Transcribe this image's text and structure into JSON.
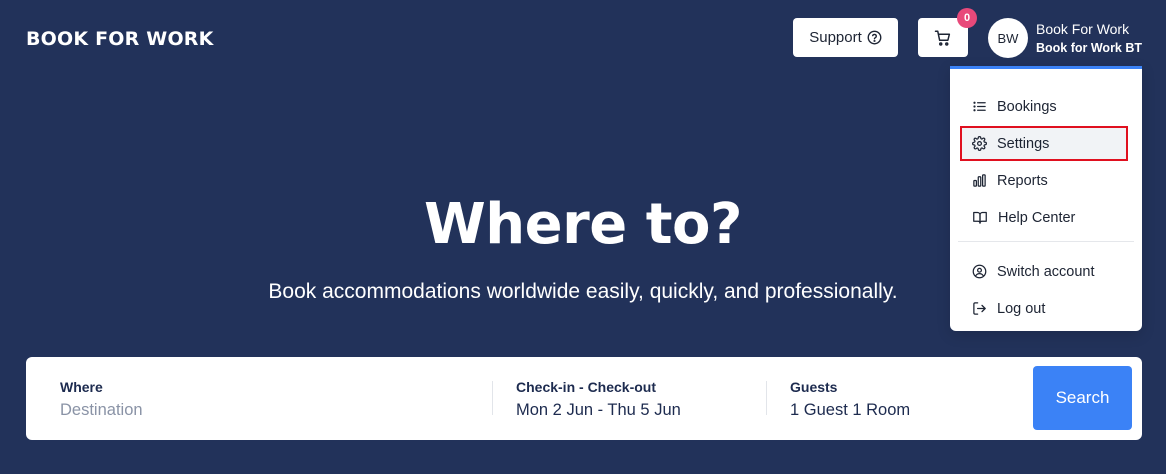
{
  "header": {
    "logo": "BOOK FOR WORK",
    "support_label": "Support",
    "cart_count": "0",
    "avatar_initials": "BW",
    "account_name": "Book For Work",
    "account_sub": "Book for Work BT"
  },
  "menu": {
    "items": [
      {
        "label": "Bookings",
        "icon": "list-icon"
      },
      {
        "label": "Settings",
        "icon": "gear-icon"
      },
      {
        "label": "Reports",
        "icon": "bar-chart-icon"
      },
      {
        "label": "Help Center",
        "icon": "book-open-icon"
      },
      {
        "label": "Switch account",
        "icon": "user-circle-icon"
      },
      {
        "label": "Log out",
        "icon": "logout-icon"
      }
    ]
  },
  "hero": {
    "title": "Where to?",
    "subtitle": "Book accommodations worldwide easily, quickly, and professionally."
  },
  "search": {
    "where_label": "Where",
    "where_placeholder": "Destination",
    "dates_label": "Check-in - Check-out",
    "dates_value": "Mon 2 Jun - Thu 5 Jun",
    "guests_label": "Guests",
    "guests_value": "1 Guest 1 Room",
    "button_label": "Search"
  },
  "colors": {
    "background": "#22325a",
    "accent": "#3b82f6",
    "badge": "#e8497a",
    "highlight_outline": "#e0101f"
  }
}
